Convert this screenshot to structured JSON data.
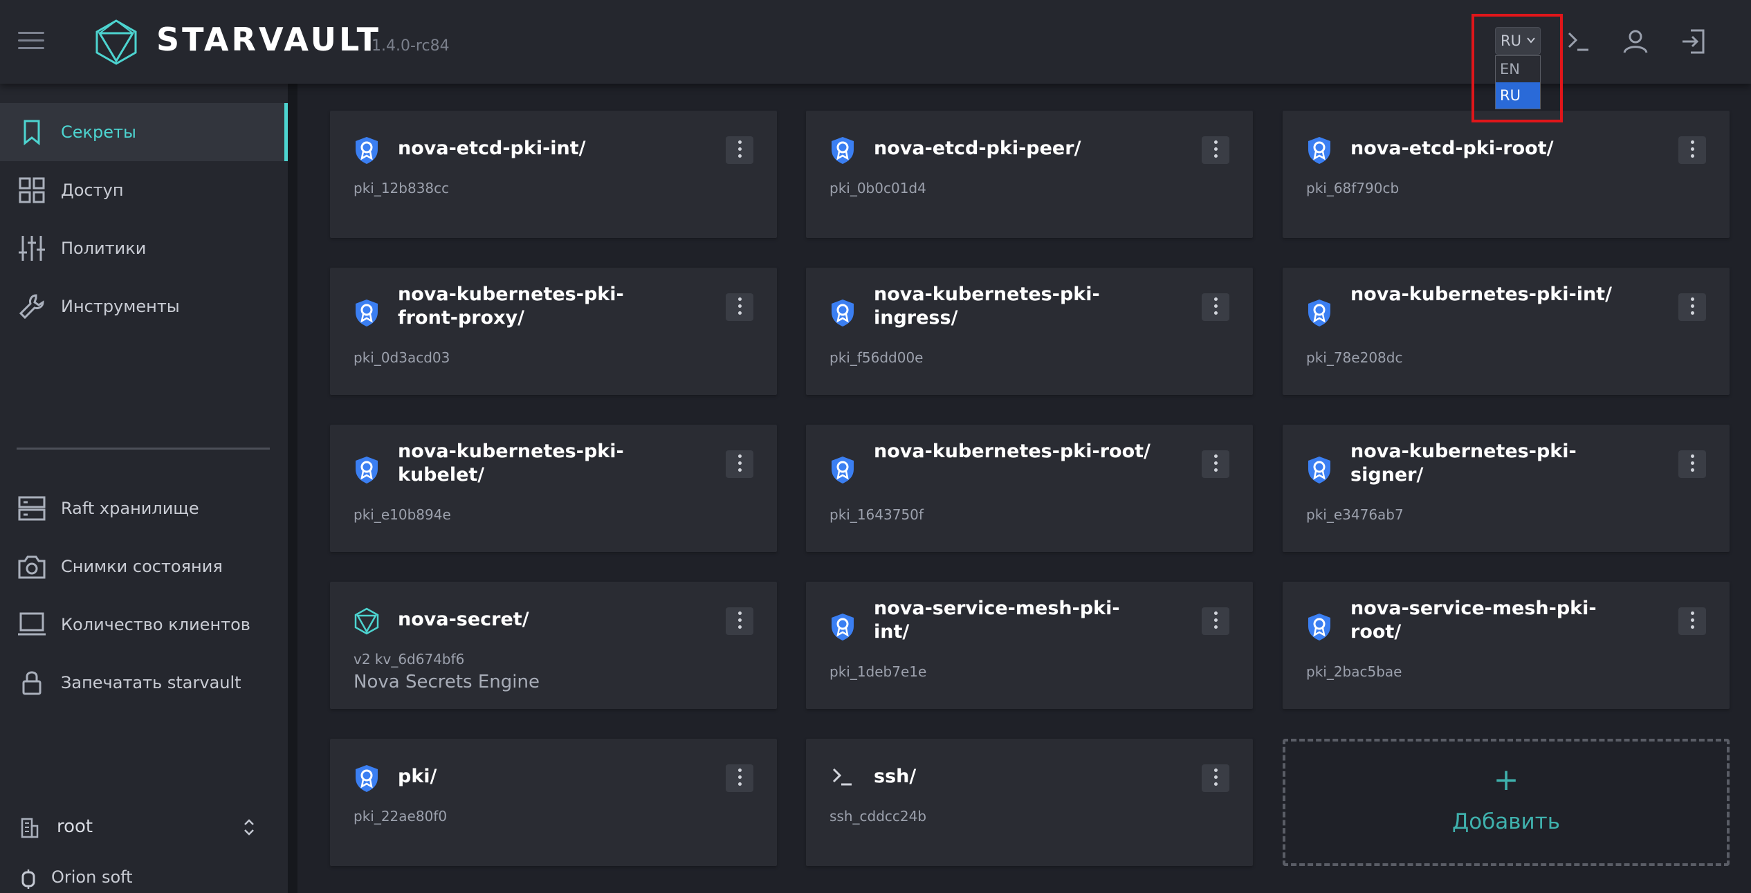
{
  "header": {
    "logo_text": "STARVAULT",
    "version": "1.4.0-rc84",
    "language": {
      "selected": "RU",
      "options": [
        "EN",
        "RU"
      ]
    }
  },
  "sidebar": {
    "items": [
      {
        "label": "Секреты",
        "icon": "bookmark-icon"
      },
      {
        "label": "Доступ",
        "icon": "grid-icon"
      },
      {
        "label": "Политики",
        "icon": "sliders-icon"
      },
      {
        "label": "Инструменты",
        "icon": "wrench-icon"
      }
    ],
    "items2": [
      {
        "label": "Raft хранилище",
        "icon": "server-icon"
      },
      {
        "label": "Снимки состояния",
        "icon": "camera-icon"
      },
      {
        "label": "Количество клиентов",
        "icon": "laptop-icon"
      },
      {
        "label": "Запечатать starvault",
        "icon": "lock-icon"
      }
    ],
    "namespace": "root",
    "org": "Orion soft"
  },
  "engines": [
    {
      "title": "nova-etcd-pki-int/",
      "sub": "pki_12b838cc",
      "icon": "certificate-shield-icon"
    },
    {
      "title": "nova-etcd-pki-peer/",
      "sub": "pki_0b0c01d4",
      "icon": "certificate-shield-icon"
    },
    {
      "title": "nova-etcd-pki-root/",
      "sub": "pki_68f790cb",
      "icon": "certificate-shield-icon"
    },
    {
      "title": "nova-kubernetes-pki-front-proxy/",
      "sub": "pki_0d3acd03",
      "icon": "certificate-shield-icon"
    },
    {
      "title": "nova-kubernetes-pki-ingress/",
      "sub": "pki_f56dd00e",
      "icon": "certificate-shield-icon"
    },
    {
      "title": "nova-kubernetes-pki-int/",
      "sub": "pki_78e208dc",
      "icon": "certificate-shield-icon"
    },
    {
      "title": "nova-kubernetes-pki-kubelet/",
      "sub": "pki_e10b894e",
      "icon": "certificate-shield-icon"
    },
    {
      "title": "nova-kubernetes-pki-root/",
      "sub": "pki_1643750f",
      "icon": "certificate-shield-icon"
    },
    {
      "title": "nova-kubernetes-pki-signer/",
      "sub": "pki_e3476ab7",
      "icon": "certificate-shield-icon"
    },
    {
      "title": "nova-secret/",
      "sub": "v2 kv_6d674bf6",
      "desc": "Nova Secrets Engine",
      "icon": "starvault-logo-icon"
    },
    {
      "title": "nova-service-mesh-pki-int/",
      "sub": "pki_1deb7e1e",
      "icon": "certificate-shield-icon"
    },
    {
      "title": "nova-service-mesh-pki-root/",
      "sub": "pki_2bac5bae",
      "icon": "certificate-shield-icon"
    },
    {
      "title": "pki/",
      "sub": "pki_22ae80f0",
      "icon": "certificate-shield-icon"
    },
    {
      "title": "ssh/",
      "sub": "ssh_cddcc24b",
      "icon": "terminal-icon"
    }
  ],
  "add_card": {
    "plus": "+",
    "label": "Добавить"
  },
  "colors": {
    "accent": "#4dd4d0",
    "primary_blue": "#2a6ad8",
    "highlight": "#e0161a"
  }
}
